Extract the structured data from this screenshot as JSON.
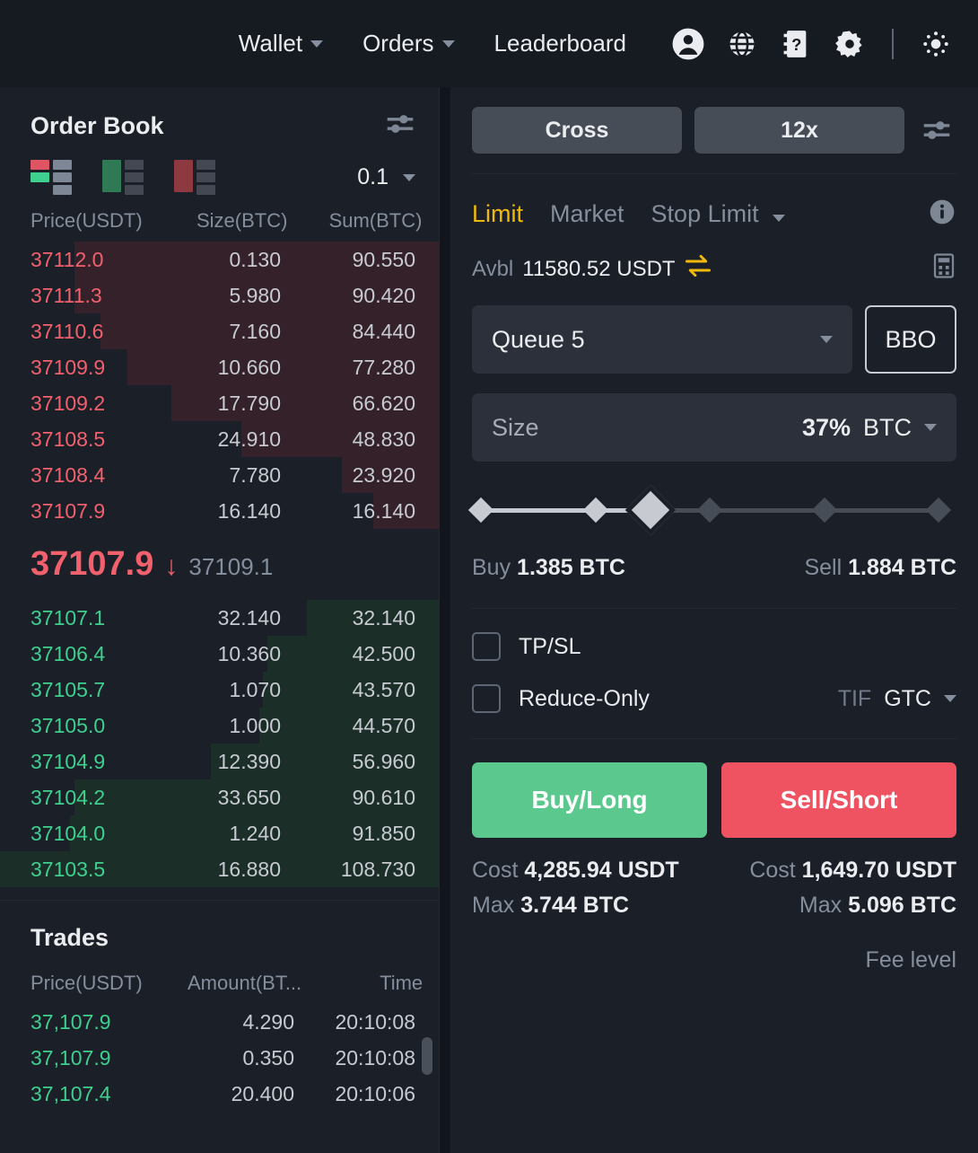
{
  "topnav": {
    "links": [
      {
        "label": "Wallet",
        "has_caret": true
      },
      {
        "label": "Orders",
        "has_caret": true
      },
      {
        "label": "Leaderboard",
        "has_caret": false
      }
    ],
    "icons": [
      "user-icon",
      "globe-icon",
      "help-icon",
      "gear-icon",
      "theme-icon"
    ]
  },
  "orderbook": {
    "title": "Order Book",
    "settings_icon": "sliders-icon",
    "tick_size": "0.1",
    "columns": {
      "price": "Price(USDT)",
      "size": "Size(BTC)",
      "sum": "Sum(BTC)"
    },
    "layout_modes": [
      "both-rows-icon",
      "bids-only-icon",
      "asks-only-icon"
    ],
    "asks": [
      {
        "price": "37112.0",
        "size": "0.130",
        "sum": "90.550",
        "depth": 83
      },
      {
        "price": "37111.3",
        "size": "5.980",
        "sum": "90.420",
        "depth": 83
      },
      {
        "price": "37110.6",
        "size": "7.160",
        "sum": "84.440",
        "depth": 77
      },
      {
        "price": "37109.9",
        "size": "10.660",
        "sum": "77.280",
        "depth": 71
      },
      {
        "price": "37109.2",
        "size": "17.790",
        "sum": "66.620",
        "depth": 61
      },
      {
        "price": "37108.5",
        "size": "24.910",
        "sum": "48.830",
        "depth": 45
      },
      {
        "price": "37108.4",
        "size": "7.780",
        "sum": "23.920",
        "depth": 22
      },
      {
        "price": "37107.9",
        "size": "16.140",
        "sum": "16.140",
        "depth": 15
      }
    ],
    "mid": {
      "last_price": "37107.9",
      "direction": "down",
      "mark_price": "37109.1"
    },
    "bids": [
      {
        "price": "37107.1",
        "size": "32.140",
        "sum": "32.140",
        "depth": 30
      },
      {
        "price": "37106.4",
        "size": "10.360",
        "sum": "42.500",
        "depth": 39
      },
      {
        "price": "37105.7",
        "size": "1.070",
        "sum": "43.570",
        "depth": 40
      },
      {
        "price": "37105.0",
        "size": "1.000",
        "sum": "44.570",
        "depth": 41
      },
      {
        "price": "37104.9",
        "size": "12.390",
        "sum": "56.960",
        "depth": 52
      },
      {
        "price": "37104.2",
        "size": "33.650",
        "sum": "90.610",
        "depth": 83
      },
      {
        "price": "37104.0",
        "size": "1.240",
        "sum": "91.850",
        "depth": 84
      },
      {
        "price": "37103.5",
        "size": "16.880",
        "sum": "108.730",
        "depth": 100
      }
    ]
  },
  "trades": {
    "title": "Trades",
    "columns": {
      "price": "Price(USDT)",
      "amount": "Amount(BT...",
      "time": "Time"
    },
    "rows": [
      {
        "price": "37,107.9",
        "amount": "4.290",
        "time": "20:10:08",
        "side": "buy"
      },
      {
        "price": "37,107.9",
        "amount": "0.350",
        "time": "20:10:08",
        "side": "buy"
      },
      {
        "price": "37,107.4",
        "amount": "20.400",
        "time": "20:10:06",
        "side": "buy"
      }
    ]
  },
  "order_form": {
    "margin_mode": "Cross",
    "leverage": "12x",
    "settings_icon": "sliders-icon",
    "order_types": [
      {
        "label": "Limit",
        "active": true,
        "caret": false
      },
      {
        "label": "Market",
        "active": false,
        "caret": false
      },
      {
        "label": "Stop Limit",
        "active": false,
        "caret": true
      }
    ],
    "info_icon": "info-icon",
    "available": {
      "label": "Avbl",
      "value": "11580.52 USDT",
      "swap_icon": "swap-icon",
      "calculator_icon": "calculator-icon"
    },
    "price_field": {
      "value": "Queue 5",
      "caret": "chevron-down-icon"
    },
    "bbo_button": "BBO",
    "size_field": {
      "placeholder": "Size",
      "percent": "37%",
      "unit": "BTC",
      "caret": "chevron-down-icon"
    },
    "slider": {
      "percent": 37,
      "nodes": [
        0,
        25,
        37,
        50,
        75,
        100
      ]
    },
    "buy_estimate": {
      "label": "Buy",
      "value": "1.385 BTC"
    },
    "sell_estimate": {
      "label": "Sell",
      "value": "1.884 BTC"
    },
    "tpsl": {
      "label": "TP/SL",
      "checked": false
    },
    "reduce_only": {
      "label": "Reduce-Only",
      "checked": false
    },
    "tif": {
      "label": "TIF",
      "value": "GTC",
      "caret": "chevron-down-icon"
    },
    "buy_button": "Buy/Long",
    "sell_button": "Sell/Short",
    "buy_summary": {
      "cost_label": "Cost",
      "cost_value": "4,285.94 USDT",
      "max_label": "Max",
      "max_value": "3.744 BTC"
    },
    "sell_summary": {
      "cost_label": "Cost",
      "cost_value": "1,649.70 USDT",
      "max_label": "Max",
      "max_value": "5.096 BTC"
    },
    "fee_level": "Fee level"
  },
  "colors": {
    "bg": "#12151c",
    "panel": "#1b1f27",
    "ask_red": "#f0616d",
    "bid_green": "#3fcf8e",
    "accent_yellow": "#f0b90b",
    "buy_button": "#5bc98d",
    "sell_button": "#ef5261"
  }
}
